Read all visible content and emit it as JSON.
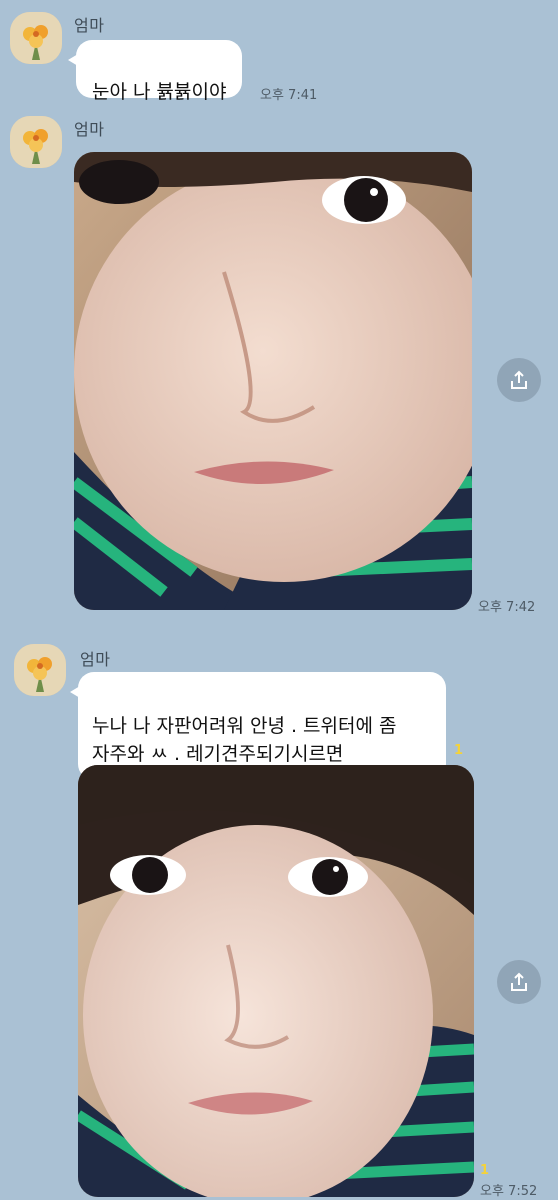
{
  "chat": {
    "messages": [
      {
        "sender": "엄마",
        "text": "눈아 나 뷹뷹이야",
        "time": "오후 7:41"
      },
      {
        "sender": "엄마",
        "type": "photo",
        "time": "오후 7:42"
      },
      {
        "sender": "엄마",
        "text": "누나 나 자판어려워 안녕 . 트위터에 좀\n자주와 ㅆ . 레기견주되기시르면",
        "unread": "1"
      },
      {
        "type": "photo",
        "unread": "1",
        "time": "오후 7:52"
      }
    ]
  },
  "icons": {
    "avatar": "flower-bouquet-avatar",
    "share": "share-upload-icon"
  },
  "colors": {
    "background": "#aac1d4",
    "bubble": "#ffffff",
    "unread": "#f4d23a"
  }
}
